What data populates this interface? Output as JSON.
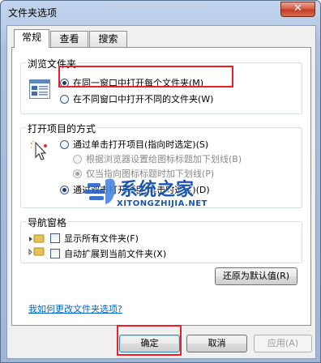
{
  "window": {
    "title": "文件夹选项",
    "close_label": "✕"
  },
  "tabs": [
    {
      "label": "常规",
      "active": true
    },
    {
      "label": "查看",
      "active": false
    },
    {
      "label": "搜索",
      "active": false
    }
  ],
  "browse_folders": {
    "label": "浏览文件夹",
    "options": [
      {
        "label": "在同一窗口中打开每个文件夹(M)",
        "checked": true
      },
      {
        "label": "在不同窗口中打开不同的文件夹(W)",
        "checked": false
      }
    ]
  },
  "open_items": {
    "label": "打开项目的方式",
    "single_click": {
      "label": "通过单击打开项目(指向时选定)(S)",
      "checked": false
    },
    "underline_options": [
      {
        "label": "根据浏览器设置给图标标题加下划线(B)",
        "checked": false
      },
      {
        "label": "仅当指向图标标题时加下划线(P)",
        "checked": true
      }
    ],
    "double_click": {
      "label": "通过双击打开项目(单击时选定)(D)",
      "checked": true
    }
  },
  "nav_pane": {
    "label": "导航窗格",
    "options": [
      {
        "label": "显示所有文件夹(F)",
        "checked": false
      },
      {
        "label": "自动扩展到当前文件夹(X)",
        "checked": false
      }
    ]
  },
  "restore_label": "还原为默认值(R)",
  "help_link": "我如何更改文件夹选项?",
  "buttons": {
    "ok": "确定",
    "cancel": "取消",
    "apply": "应用(A)"
  },
  "watermark": {
    "brand": "系统之家",
    "url": "XITONGZHIJIA.NET"
  },
  "colors": {
    "highlight": "#e8202a",
    "link": "#0066cc",
    "accent": "#1a56b0"
  }
}
